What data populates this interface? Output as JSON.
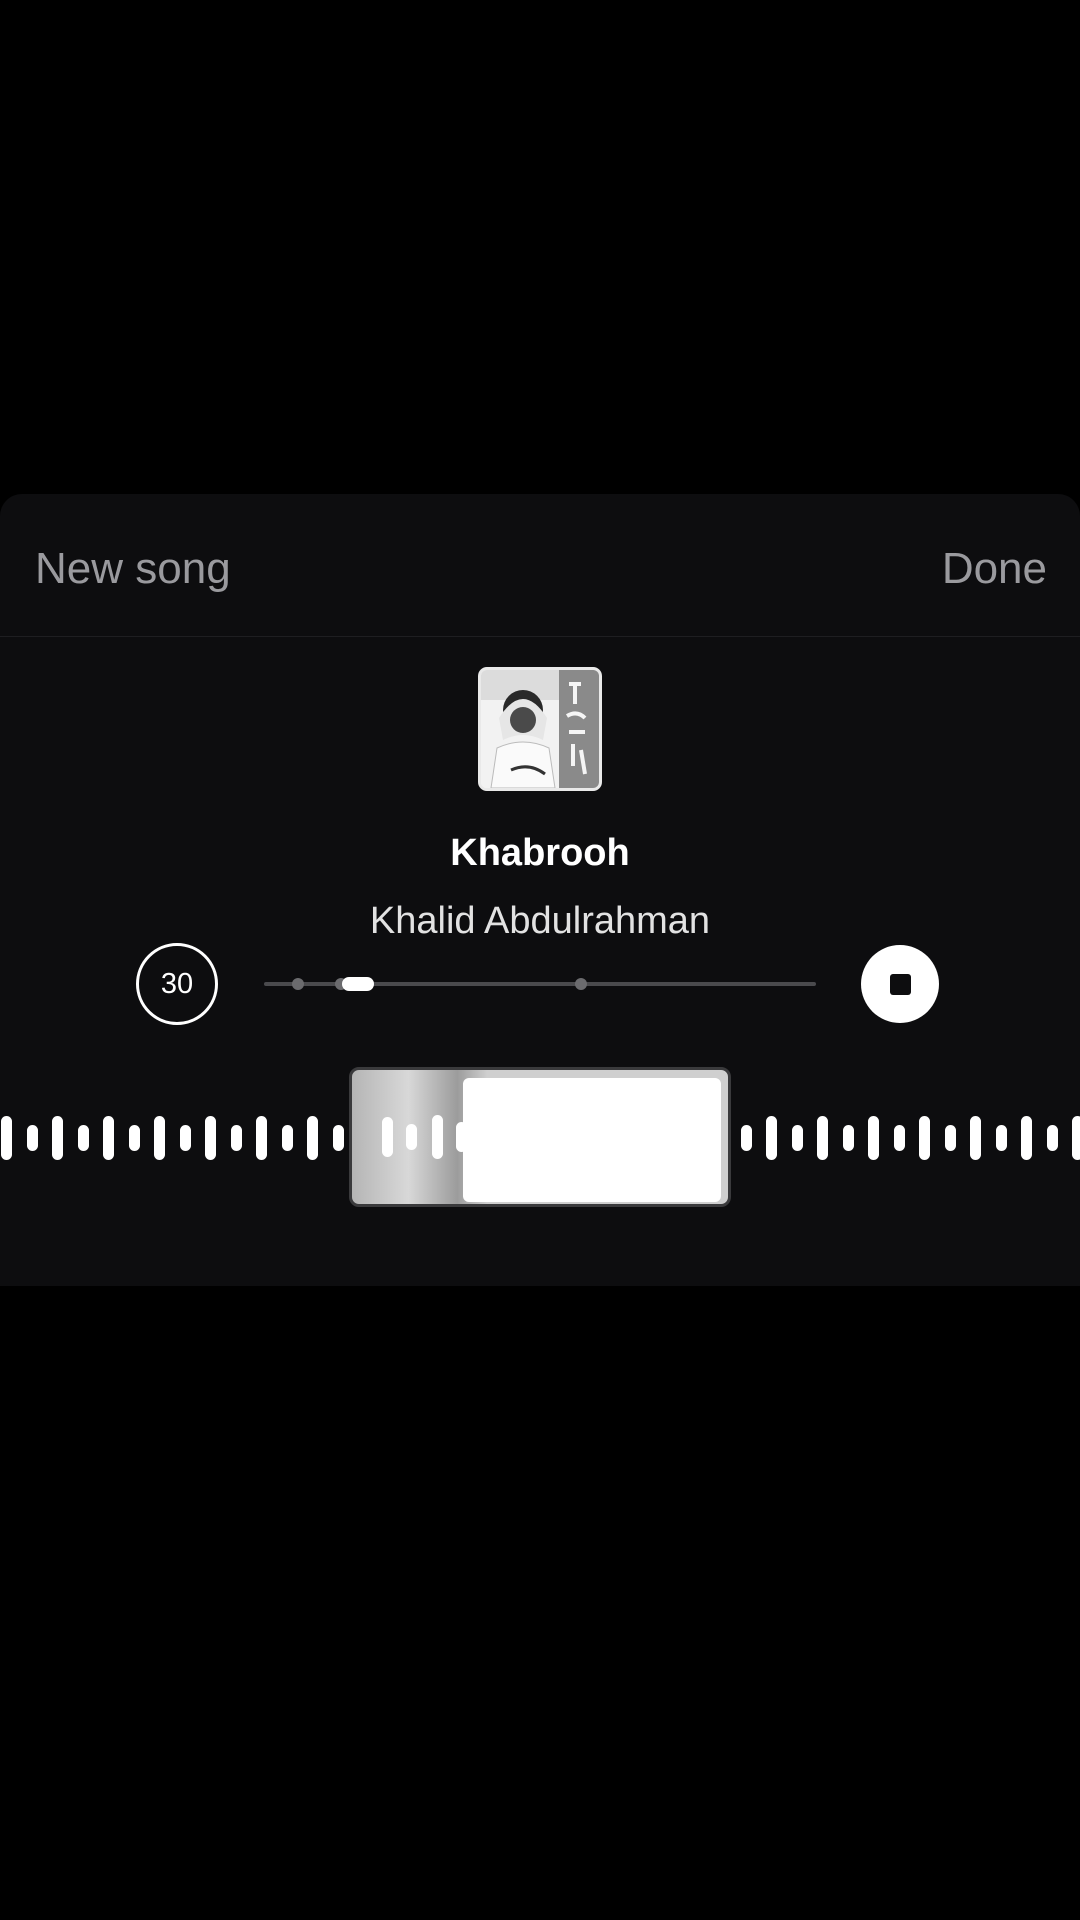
{
  "header": {
    "left_label": "New song",
    "right_label": "Done"
  },
  "song": {
    "title": "Khabrooh",
    "artist": "Khalid Abdulrahman",
    "artwork": "album-artwork"
  },
  "controls": {
    "duration_label": "30",
    "stop_icon": "stop-icon"
  },
  "colors": {
    "background": "#000000",
    "sheet": "#0d0d0f",
    "header_text": "#9a9a9e",
    "accent": "#ffffff"
  }
}
